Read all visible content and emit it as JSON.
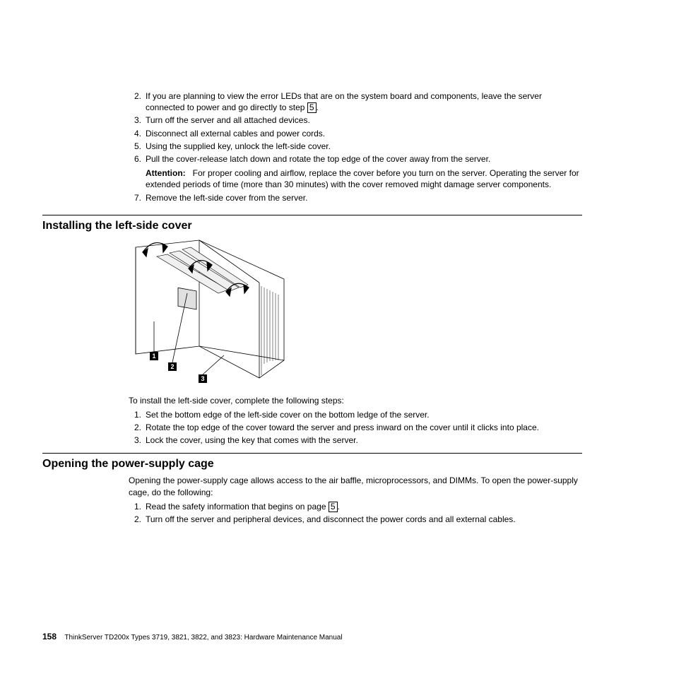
{
  "topList": {
    "item2_prefix": "If you are planning to view the error LEDs that are on the system board and components, leave the server connected to power and go directly to step ",
    "item2_link": "5",
    "item2_suffix": ".",
    "item3": "Turn off the server and all attached devices.",
    "item4": "Disconnect all external cables and power cords.",
    "item5": "Using the supplied key, unlock the left-side cover.",
    "item6": "Pull the cover-release latch down and rotate the top edge of the cover away from the server.",
    "attention_label": "Attention:",
    "attention_text": "For proper cooling and airflow, replace the cover before you turn on the server. Operating the server for extended periods of time (more than 30 minutes) with the cover removed might damage server components.",
    "item7": "Remove the left-side cover from the server."
  },
  "section1": {
    "heading": "Installing the left-side cover",
    "callout1": "1",
    "callout2": "2",
    "callout3": "3",
    "intro": "To install the left-side cover, complete the following steps:",
    "step1": "Set the bottom edge of the left-side cover on the bottom ledge of the server.",
    "step2": "Rotate the top edge of the cover toward the server and press inward on the cover until it clicks into place.",
    "step3": "Lock the cover, using the key that comes with the server."
  },
  "section2": {
    "heading": "Opening the power-supply cage",
    "intro": "Opening the power-supply cage allows access to the air baffle, microprocessors, and DIMMs. To open the power-supply cage, do the following:",
    "step1_prefix": "Read the safety information that begins on page ",
    "step1_link": "5",
    "step1_suffix": ".",
    "step2": "Turn off the server and peripheral devices, and disconnect the power cords and all external cables."
  },
  "footer": {
    "page": "158",
    "text": "ThinkServer TD200x Types 3719, 3821, 3822, and 3823:  Hardware Maintenance Manual"
  }
}
